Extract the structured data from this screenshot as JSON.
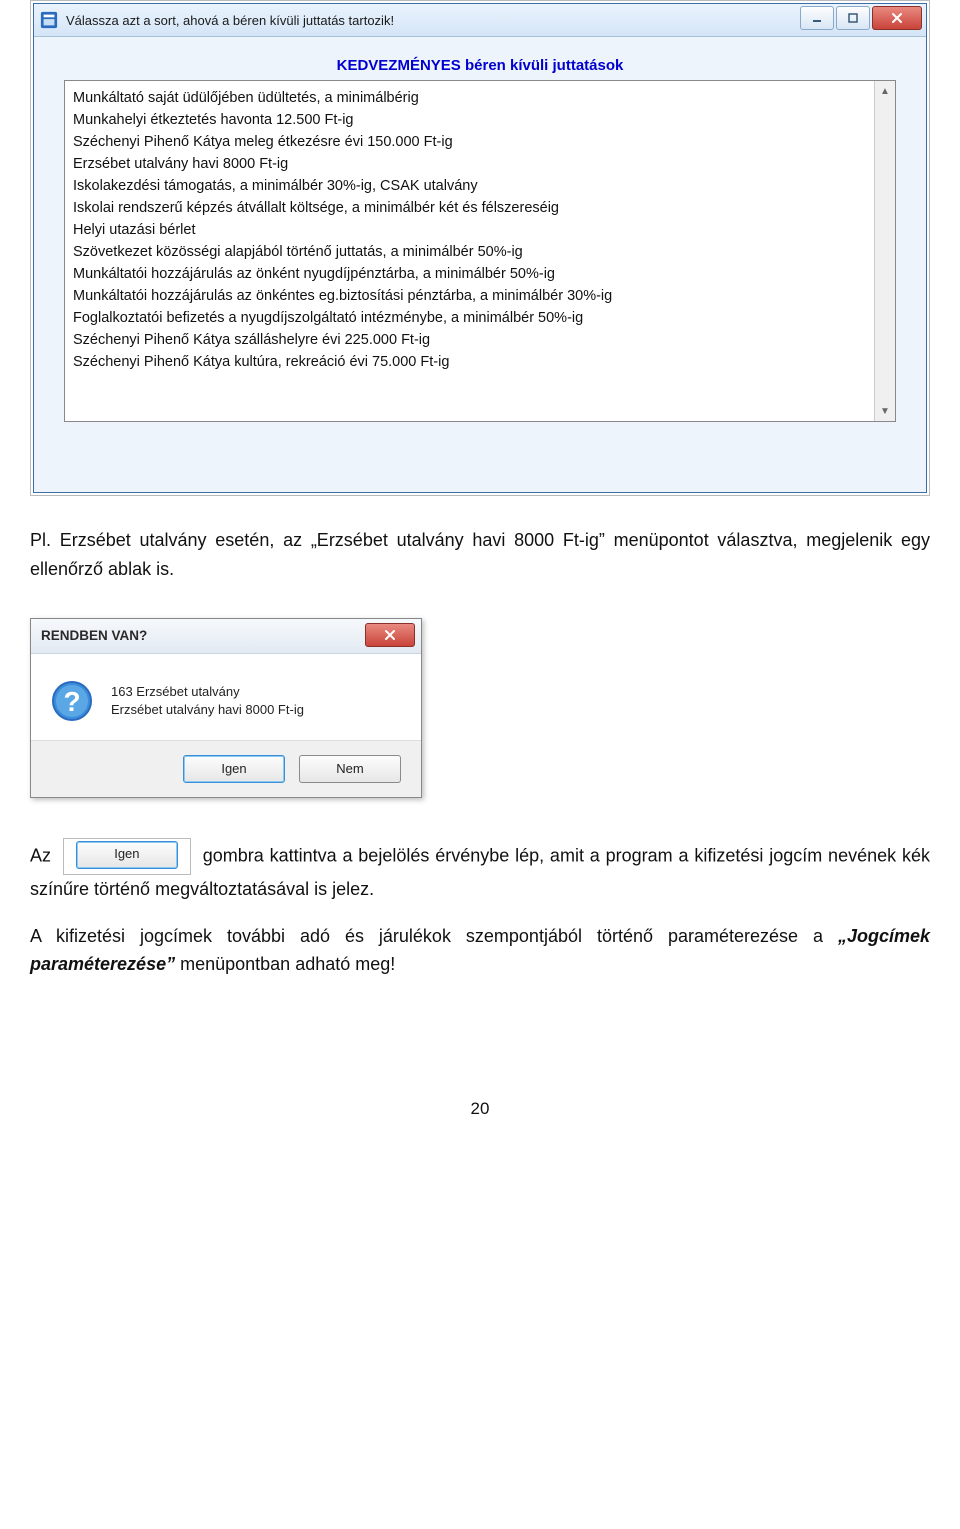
{
  "window1": {
    "title": "Válassza azt a sort, ahová a béren kívüli juttatás tartozik!",
    "header": "KEDVEZMÉNYES béren kívüli juttatások",
    "items": [
      "Munkáltató saját üdülőjében üdültetés, a minimálbérig",
      "Munkahelyi étkeztetés havonta 12.500 Ft-ig",
      "Széchenyi Pihenő Kátya meleg étkezésre évi 150.000 Ft-ig",
      "Erzsébet utalvány havi 8000 Ft-ig",
      "Iskolakezdési támogatás, a minimálbér 30%-ig, CSAK utalvány",
      "Iskolai rendszerű képzés átvállalt költsége, a minimálbér két és félszereséig",
      "Helyi utazási bérlet",
      "Szövetkezet közösségi alapjából történő juttatás, a minimálbér 50%-ig",
      "Munkáltatói hozzájárulás az önként nyugdíjpénztárba, a minimálbér 50%-ig",
      "Munkáltatói hozzájárulás az önkéntes eg.biztosítási pénztárba, a minimálbér 30%-ig",
      "Foglalkoztatói befizetés a nyugdíjszolgáltató intézménybe, a minimálbér 50%-ig",
      "Széchenyi Pihenő Kátya szálláshelyre évi 225.000 Ft-ig",
      "Széchenyi Pihenő Kátya kultúra, rekreáció évi 75.000 Ft-ig"
    ]
  },
  "para1_a": "Pl. Erzsébet utalvány esetén, az „Erzsébet utalvány havi 8000 Ft-ig” menüpontot választva, megjelenik egy ellenőrző ablak is.",
  "dialog": {
    "title": "RENDBEN VAN?",
    "line1": "163 Erzsébet utalvány",
    "line2": "Erzsébet utalvány havi 8000 Ft-ig",
    "yes": "Igen",
    "no": "Nem"
  },
  "para2_a": "Az",
  "para2_btn": "Igen",
  "para2_b": "gombra kattintva a bejelölés érvénybe lép, amit a program a kifizetési jogcím nevének kék színűre történő megváltoztatásával is jelez.",
  "para3_a": "A kifizetési jogcímek további adó és járulékok szempontjából történő paraméterezése a ",
  "para3_bold": "„Jogcímek paraméterezése”",
  "para3_b": " menüpontban adható meg!",
  "page_number": "20"
}
